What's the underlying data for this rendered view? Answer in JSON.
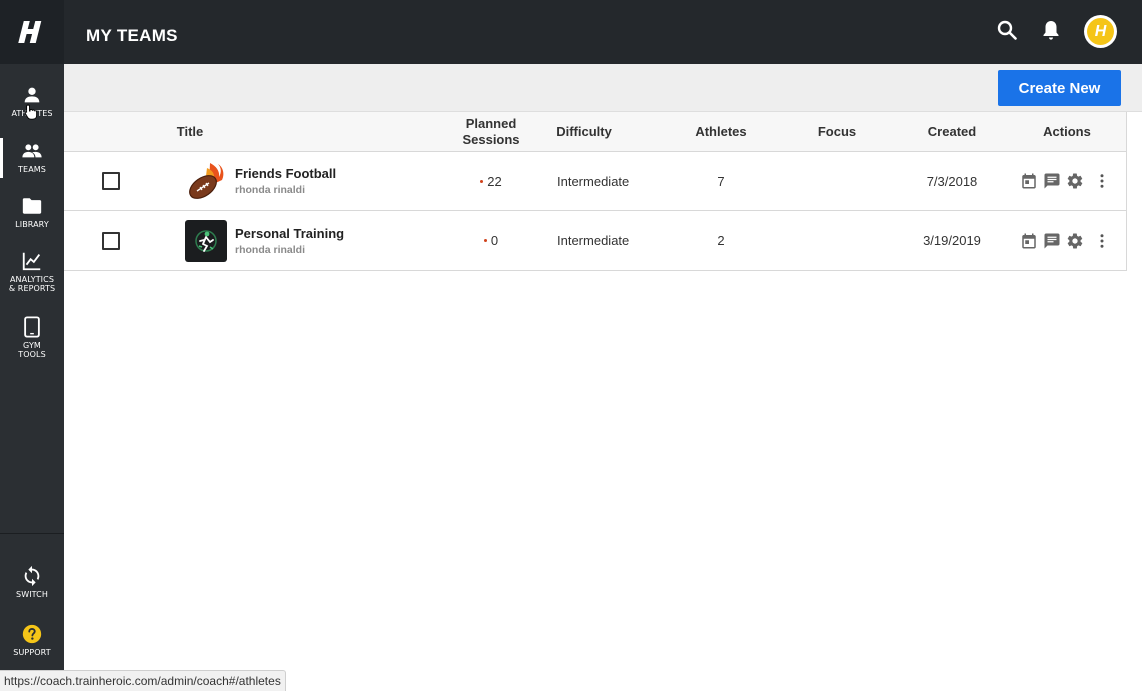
{
  "header": {
    "title": "MY TEAMS",
    "avatar_letter": "H"
  },
  "sidebar": {
    "items": [
      {
        "key": "athletes",
        "label": "ATHLETES"
      },
      {
        "key": "teams",
        "label": "TEAMS"
      },
      {
        "key": "library",
        "label": "LIBRARY"
      },
      {
        "key": "analytics",
        "label_line1": "ANALYTICS",
        "label_line2": "& REPORTS"
      },
      {
        "key": "gym",
        "label_line1": "GYM",
        "label_line2": "TOOLS"
      },
      {
        "key": "switch",
        "label": "SWITCH"
      },
      {
        "key": "support",
        "label": "SUPPORT"
      }
    ]
  },
  "toolbar": {
    "create_label": "Create New"
  },
  "table": {
    "columns": {
      "title": "Title",
      "planned_line1": "Planned",
      "planned_line2": "Sessions",
      "difficulty": "Difficulty",
      "athletes": "Athletes",
      "focus": "Focus",
      "created": "Created",
      "actions": "Actions"
    },
    "rows": [
      {
        "name": "Friends Football",
        "owner": "rhonda rinaldi",
        "planned_sessions": "22",
        "difficulty": "Intermediate",
        "athletes": "7",
        "focus": "",
        "created": "7/3/2018"
      },
      {
        "name": "Personal Training",
        "owner": "rhonda rinaldi",
        "planned_sessions": "0",
        "difficulty": "Intermediate",
        "athletes": "2",
        "focus": "",
        "created": "3/19/2019"
      }
    ]
  },
  "statusbar": {
    "url": "https://coach.trainheroic.com/admin/coach#/athletes"
  },
  "colors": {
    "accent": "#1a73e8",
    "sidebar": "#2b2f33",
    "topbar": "#24282c",
    "logo_yellow": "#f5c518",
    "session_dot": "#d0431b"
  }
}
